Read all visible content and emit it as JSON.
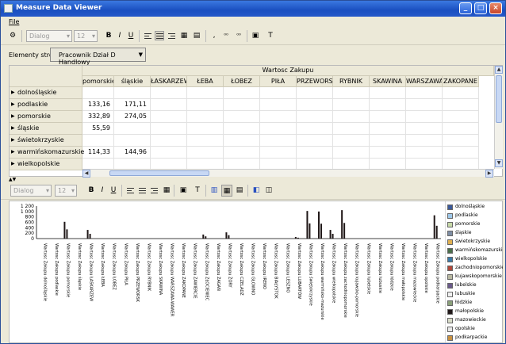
{
  "window": {
    "title": "Measure Data Viewer"
  },
  "menu": {
    "file": "File"
  },
  "toolbar1": {
    "font_name": "Dialog",
    "font_size": "12",
    "bold": "B",
    "italic": "I",
    "underline": "U"
  },
  "filter": {
    "label": "Elementy strony",
    "selected": "Pracownik Dział D  Handlowy"
  },
  "pivot": {
    "measure_header": "Wartosc Zakupu",
    "columns": [
      "pomorskie",
      "śląskie",
      "ŁASKARZEW",
      "ŁEBA",
      "ŁOBEZ",
      "PIŁA",
      "PRZEWORSK",
      "RYBNIK",
      "SKAWINA",
      "WARSZAWA",
      "ZAKOPANE"
    ],
    "rows": [
      {
        "label": "dolnośląskie",
        "values": [
          "",
          "",
          "",
          "",
          "",
          "",
          "",
          "",
          "",
          "",
          ""
        ]
      },
      {
        "label": "podlaskie",
        "values": [
          "133,16",
          "171,11",
          "",
          "",
          "",
          "",
          "",
          "",
          "",
          "",
          ""
        ]
      },
      {
        "label": "pomorskie",
        "values": [
          "332,89",
          "274,05",
          "",
          "",
          "",
          "",
          "",
          "",
          "",
          "",
          ""
        ]
      },
      {
        "label": "śląskie",
        "values": [
          "55,59",
          "",
          "",
          "",
          "",
          "",
          "",
          "",
          "",
          "",
          ""
        ]
      },
      {
        "label": "świetokrzyskie",
        "values": [
          "",
          "",
          "",
          "",
          "",
          "",
          "",
          "",
          "",
          "",
          ""
        ]
      },
      {
        "label": "warmińskomazurskie",
        "values": [
          "114,33",
          "144,96",
          "",
          "",
          "",
          "",
          "",
          "",
          "",
          "",
          ""
        ]
      },
      {
        "label": "wielkopolskie",
        "values": [
          "",
          "",
          "",
          "",
          "",
          "",
          "",
          "",
          "",
          "",
          ""
        ]
      }
    ]
  },
  "toolbar2": {
    "font_name": "Dialog",
    "font_size": "12",
    "bold": "B",
    "italic": "I",
    "underline": "U"
  },
  "chart_data": {
    "type": "bar",
    "title": "",
    "ylim": [
      0,
      1200
    ],
    "yticks": [
      "1 200",
      "1 000",
      "800",
      "600",
      "400",
      "200",
      "0"
    ],
    "categories": [
      "Wartosc Zakupu dolnośląskie",
      "Wartosc Zakupu podlaskie",
      "Wartosc Zakupu pomorskie",
      "Wartosc Zakupu śląskie",
      "Wartosc Zakupu ŁASKARZEW",
      "Wartosc Zakupu ŁEBA",
      "Wartosc Zakupu ŁOBEZ",
      "Wartosc Zakupu PIŁA",
      "Wartosc Zakupu PRZEWORSK",
      "Wartosc Zakupu RYBNIK",
      "Wartosc Zakupu SKAWINA",
      "Wartosc Zakupu WARSZAWA-WAWER",
      "Wartosc Zakupu ZAKOPANE",
      "Wartosc Zakupu ZAWIERCIE",
      "Wartosc Zakupu ZŁOCIENIEC",
      "Wartosc Zakupu ŻAGAŃ",
      "Wartosc Zakupu ŻORY",
      "Wartosc Zakupu CZELADŹ",
      "Wartosc Zakupu GŁOWNO",
      "Wartosc Zakupu IRENO",
      "Wartosc Zakupu BIAŁYSTOK",
      "Wartosc Zakupu LESZNO",
      "Wartosc Zakupu LUBARTÓW",
      "Wartosc Zakupu świętokrzyskie",
      "Wartosc Zakupu warmińsko-mazurskie",
      "Wartosc Zakupu wielkopolskie",
      "Wartosc Zakupu zachodniopomorskie",
      "Wartosc Zakupu kujawsko-pomorskie",
      "Wartosc Zakupu lubelskie",
      "Wartosc Zakupu lubuskie",
      "Wartosc Zakupu łódzkie",
      "Wartosc Zakupu małopolskie",
      "Wartosc Zakupu mazowieckie",
      "Wartosc Zakupu opolskie",
      "Wartosc Zakupu podkarpackie"
    ],
    "values": [
      0,
      0,
      620,
      0,
      320,
      0,
      0,
      0,
      0,
      0,
      0,
      0,
      0,
      0,
      150,
      0,
      230,
      0,
      0,
      0,
      0,
      0,
      60,
      1020,
      1000,
      320,
      1050,
      0,
      0,
      0,
      0,
      0,
      0,
      0,
      860
    ],
    "legend": [
      {
        "name": "dolnośląskie",
        "color": "#3c5a9a"
      },
      {
        "name": "podlaskie",
        "color": "#9ec8ea"
      },
      {
        "name": "pomorskie",
        "color": "#c7d9a8"
      },
      {
        "name": "śląskie",
        "color": "#7e8ea4"
      },
      {
        "name": "świetokrzyskie",
        "color": "#e0b050"
      },
      {
        "name": "warmińskomazurskie",
        "color": "#4a6e4a"
      },
      {
        "name": "wielkopolskie",
        "color": "#3a7aa8"
      },
      {
        "name": "zachodniopomorskie",
        "color": "#b0483a"
      },
      {
        "name": "kujawskopomorskie",
        "color": "#b8b8a0"
      },
      {
        "name": "lubelskie",
        "color": "#6a5a8a"
      },
      {
        "name": "lubuskie",
        "color": "#f0f0f0"
      },
      {
        "name": "łódzkie",
        "color": "#8aa07a"
      },
      {
        "name": "małopolskie",
        "color": "#201818"
      },
      {
        "name": "mazowieckie",
        "color": "#d8dcc8"
      },
      {
        "name": "opolskie",
        "color": "#e8e8e8"
      },
      {
        "name": "podkarpackie",
        "color": "#c89040"
      }
    ]
  }
}
